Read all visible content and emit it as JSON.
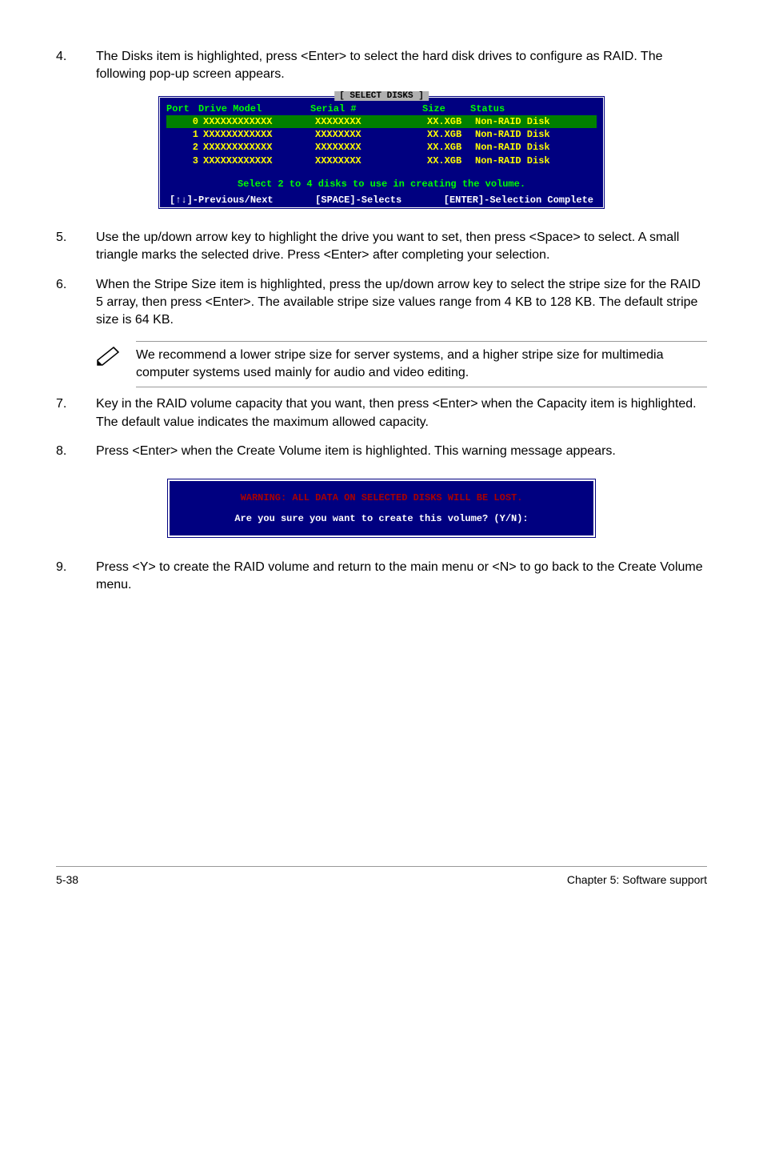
{
  "steps": {
    "s4": {
      "num": "4.",
      "text": "The Disks item is highlighted, press <Enter> to select the hard disk drives to configure as RAID. The following pop-up screen appears."
    },
    "s5": {
      "num": "5.",
      "text": "Use the up/down arrow key to highlight the drive you want to set, then press <Space> to select. A small triangle marks the selected drive. Press <Enter> after completing your selection."
    },
    "s6": {
      "num": "6.",
      "text": "When the Stripe Size item is highlighted, press the up/down arrow key to select the stripe size for the RAID 5 array, then press <Enter>. The available stripe size values range from 4 KB to 128 KB. The default stripe size is 64 KB."
    },
    "s7": {
      "num": "7.",
      "text": "Key in the RAID volume capacity that you want, then press <Enter> when the Capacity item is highlighted. The default value indicates the maximum allowed capacity."
    },
    "s8": {
      "num": "8.",
      "text": "Press <Enter> when the Create Volume item is highlighted. This warning message appears."
    },
    "s9": {
      "num": "9.",
      "text": "Press <Y> to create the RAID volume and return to the main menu or <N> to go back to the Create Volume menu."
    }
  },
  "note": "We recommend a lower stripe size for server systems, and a higher stripe size for multimedia computer systems used mainly for audio and video editing.",
  "bios": {
    "title": "[ SELECT DISKS ]",
    "headers": {
      "port": "Port",
      "model": "Drive Model",
      "serial": "Serial #",
      "size": "Size",
      "status": "Status"
    },
    "rows": [
      {
        "port": "0",
        "model": "XXXXXXXXXXXX",
        "serial": "XXXXXXXX",
        "size": "XX.XGB",
        "status": "Non-RAID Disk"
      },
      {
        "port": "1",
        "model": "XXXXXXXXXXXX",
        "serial": "XXXXXXXX",
        "size": "XX.XGB",
        "status": "Non-RAID Disk"
      },
      {
        "port": "2",
        "model": "XXXXXXXXXXXX",
        "serial": "XXXXXXXX",
        "size": "XX.XGB",
        "status": "Non-RAID Disk"
      },
      {
        "port": "3",
        "model": "XXXXXXXXXXXX",
        "serial": "XXXXXXXX",
        "size": "XX.XGB",
        "status": "Non-RAID Disk"
      }
    ],
    "hint": "Select 2 to 4 disks to use in creating the volume.",
    "footer": {
      "left": "[↑↓]-Previous/Next",
      "mid": "[SPACE]-Selects",
      "right": "[ENTER]-Selection Complete"
    }
  },
  "warning": {
    "warn": "WARNING: ALL DATA ON SELECTED DISKS WILL BE LOST.",
    "prompt": "Are you sure you want to create this volume? (Y/N):"
  },
  "footer": {
    "left": "5-38",
    "right": "Chapter 5: Software support"
  }
}
